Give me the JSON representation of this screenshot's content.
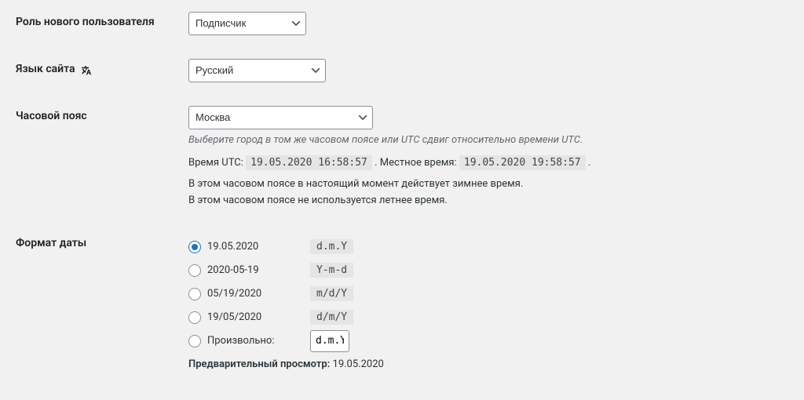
{
  "role": {
    "label": "Роль нового пользователя",
    "selected": "Подписчик"
  },
  "language": {
    "label": "Язык сайта",
    "selected": "Русский"
  },
  "timezone": {
    "label": "Часовой пояс",
    "selected": "Москва",
    "hint": "Выберите город в том же часовом поясе или UTC сдвиг относительно времени UTC.",
    "utc_label": "Время UTC:",
    "utc_value": "19.05.2020 16:58:57",
    "local_label": "Местное время:",
    "local_value": "19.05.2020 19:58:57",
    "dot": ".",
    "note1": "В этом часовом поясе в настоящий момент действует зимнее время.",
    "note2": "В этом часовом поясе не используется летнее время."
  },
  "date_format": {
    "label": "Формат даты",
    "options": [
      {
        "display": "19.05.2020",
        "code": "d.m.Y",
        "checked": true
      },
      {
        "display": "2020-05-19",
        "code": "Y-m-d",
        "checked": false
      },
      {
        "display": "05/19/2020",
        "code": "m/d/Y",
        "checked": false
      },
      {
        "display": "19/05/2020",
        "code": "d/m/Y",
        "checked": false
      }
    ],
    "custom_label": "Произвольно:",
    "custom_value": "d.m.Y",
    "preview_label": "Предварительный просмотр:",
    "preview_value": "19.05.2020"
  }
}
